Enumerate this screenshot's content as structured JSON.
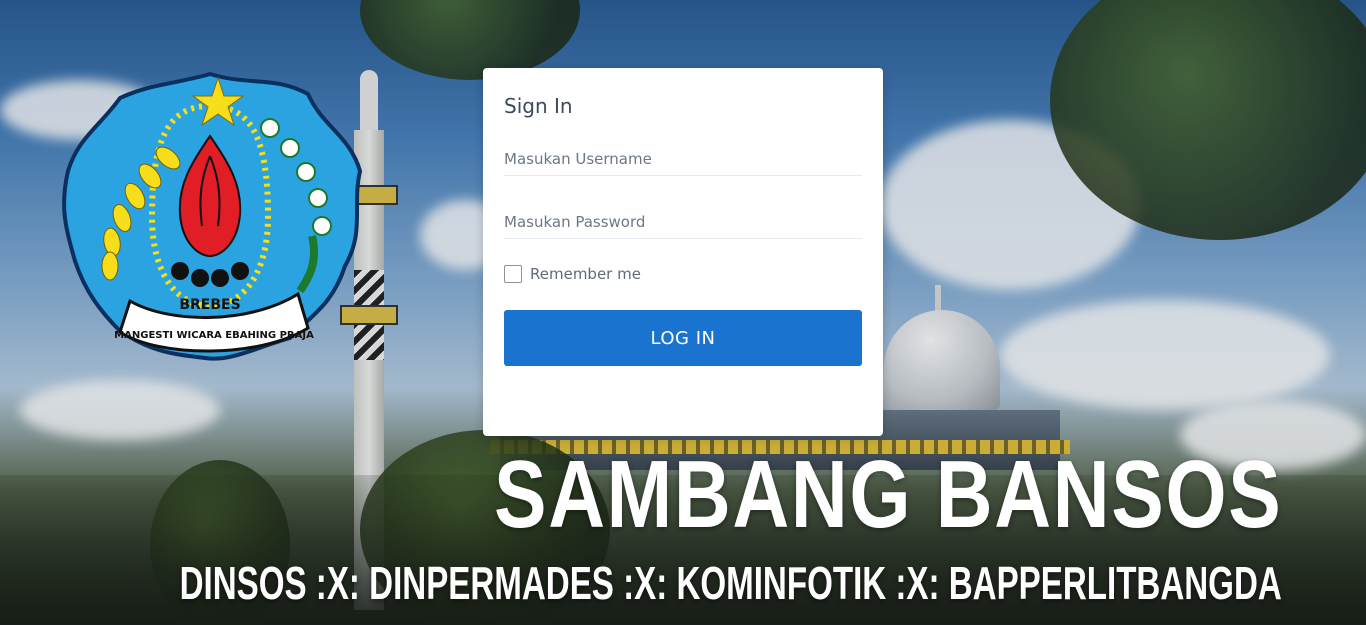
{
  "login": {
    "title": "Sign In",
    "username_placeholder": "Masukan Username",
    "password_placeholder": "Masukan Password",
    "remember_label": "Remember me",
    "login_button": "LOG IN"
  },
  "branding": {
    "title": "SAMBANG BANSOS",
    "subtitle": "DINSOS :X: DINPERMADES :X: KOMINFOTIK :X: BAPPERLITBANGDA"
  },
  "logo": {
    "name": "BREBES",
    "motto": "MANGESTI WICARA EBAHING PRAJA"
  },
  "colors": {
    "accent": "#1b73d0",
    "logo_blue": "#2aa3e0",
    "logo_yellow": "#f6df1a",
    "logo_red": "#e11d26"
  }
}
